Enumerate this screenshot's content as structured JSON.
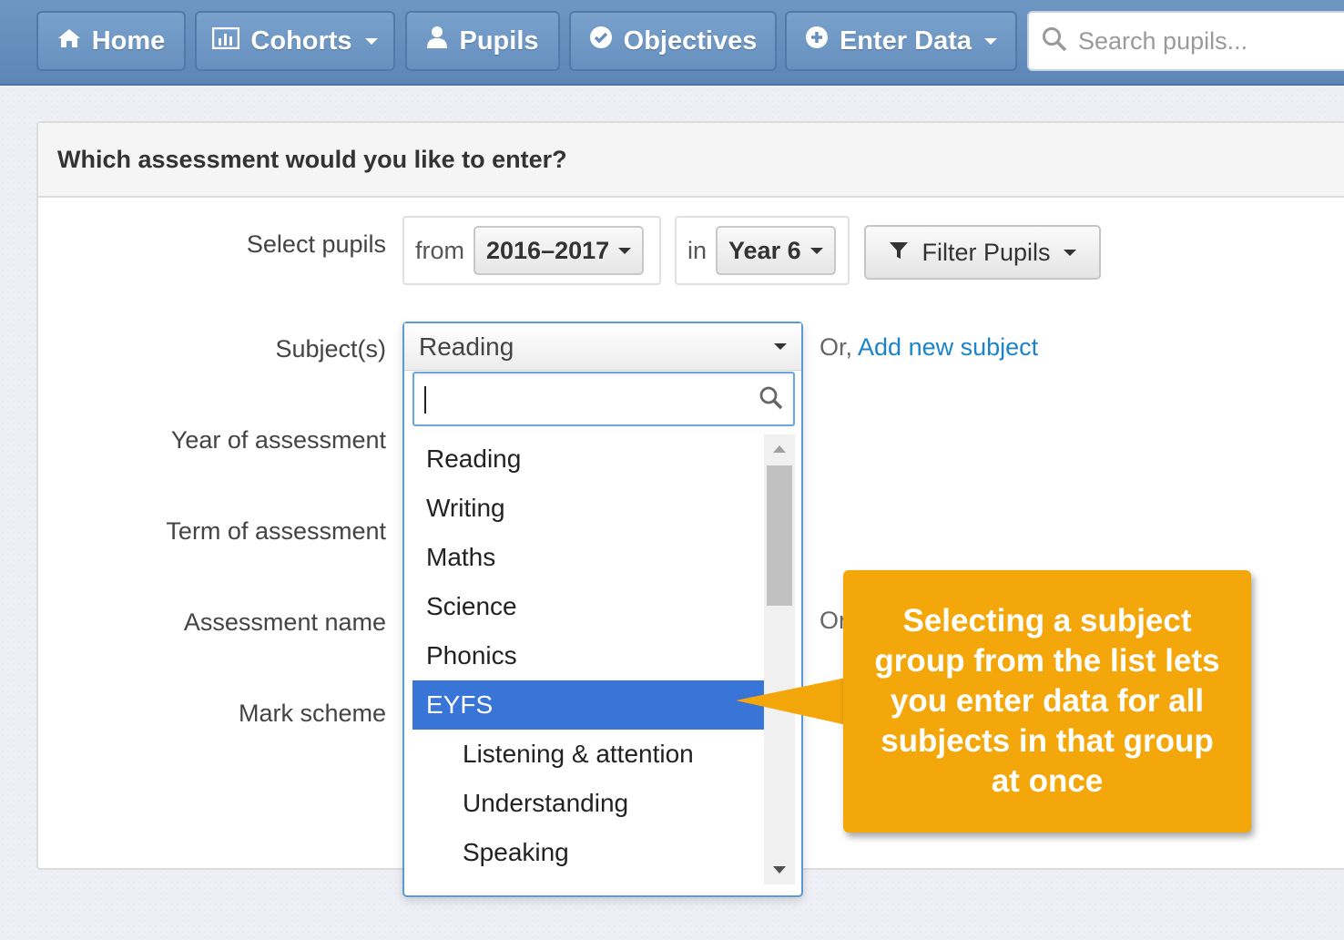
{
  "nav": {
    "home": "Home",
    "cohorts": "Cohorts",
    "pupils": "Pupils",
    "objectives": "Objectives",
    "enter_data": "Enter Data",
    "search_placeholder": "Search pupils..."
  },
  "panel": {
    "title": "Which assessment would you like to enter?"
  },
  "form": {
    "select_pupils_label": "Select pupils",
    "from_label": "from",
    "year_range": "2016–2017",
    "in_label": "in",
    "year_group": "Year 6",
    "filter_button": "Filter Pupils",
    "subjects_label": "Subject(s)",
    "subject_selected": "Reading",
    "or_text": "Or,",
    "add_subject_link": "Add new subject",
    "year_assessment_label": "Year of assessment",
    "term_assessment_label": "Term of assessment",
    "assessment_name_label": "Assessment name",
    "assessment_name_or": "Or",
    "mark_scheme_label": "Mark scheme"
  },
  "dropdown": {
    "search_value": "",
    "items": [
      {
        "label": "Reading",
        "sub": false,
        "active": false
      },
      {
        "label": "Writing",
        "sub": false,
        "active": false
      },
      {
        "label": "Maths",
        "sub": false,
        "active": false
      },
      {
        "label": "Science",
        "sub": false,
        "active": false
      },
      {
        "label": "Phonics",
        "sub": false,
        "active": false
      },
      {
        "label": "EYFS",
        "sub": false,
        "active": true
      },
      {
        "label": "Listening & attention",
        "sub": true,
        "active": false
      },
      {
        "label": "Understanding",
        "sub": true,
        "active": false
      },
      {
        "label": "Speaking",
        "sub": true,
        "active": false
      }
    ]
  },
  "callout": {
    "text": "Selecting a subject group from the list lets you enter data for all subjects in that group at once"
  },
  "colors": {
    "navbar": "#5b86b6",
    "active_item": "#3875d7",
    "callout": "#f4a70a",
    "link": "#1b84c9"
  }
}
